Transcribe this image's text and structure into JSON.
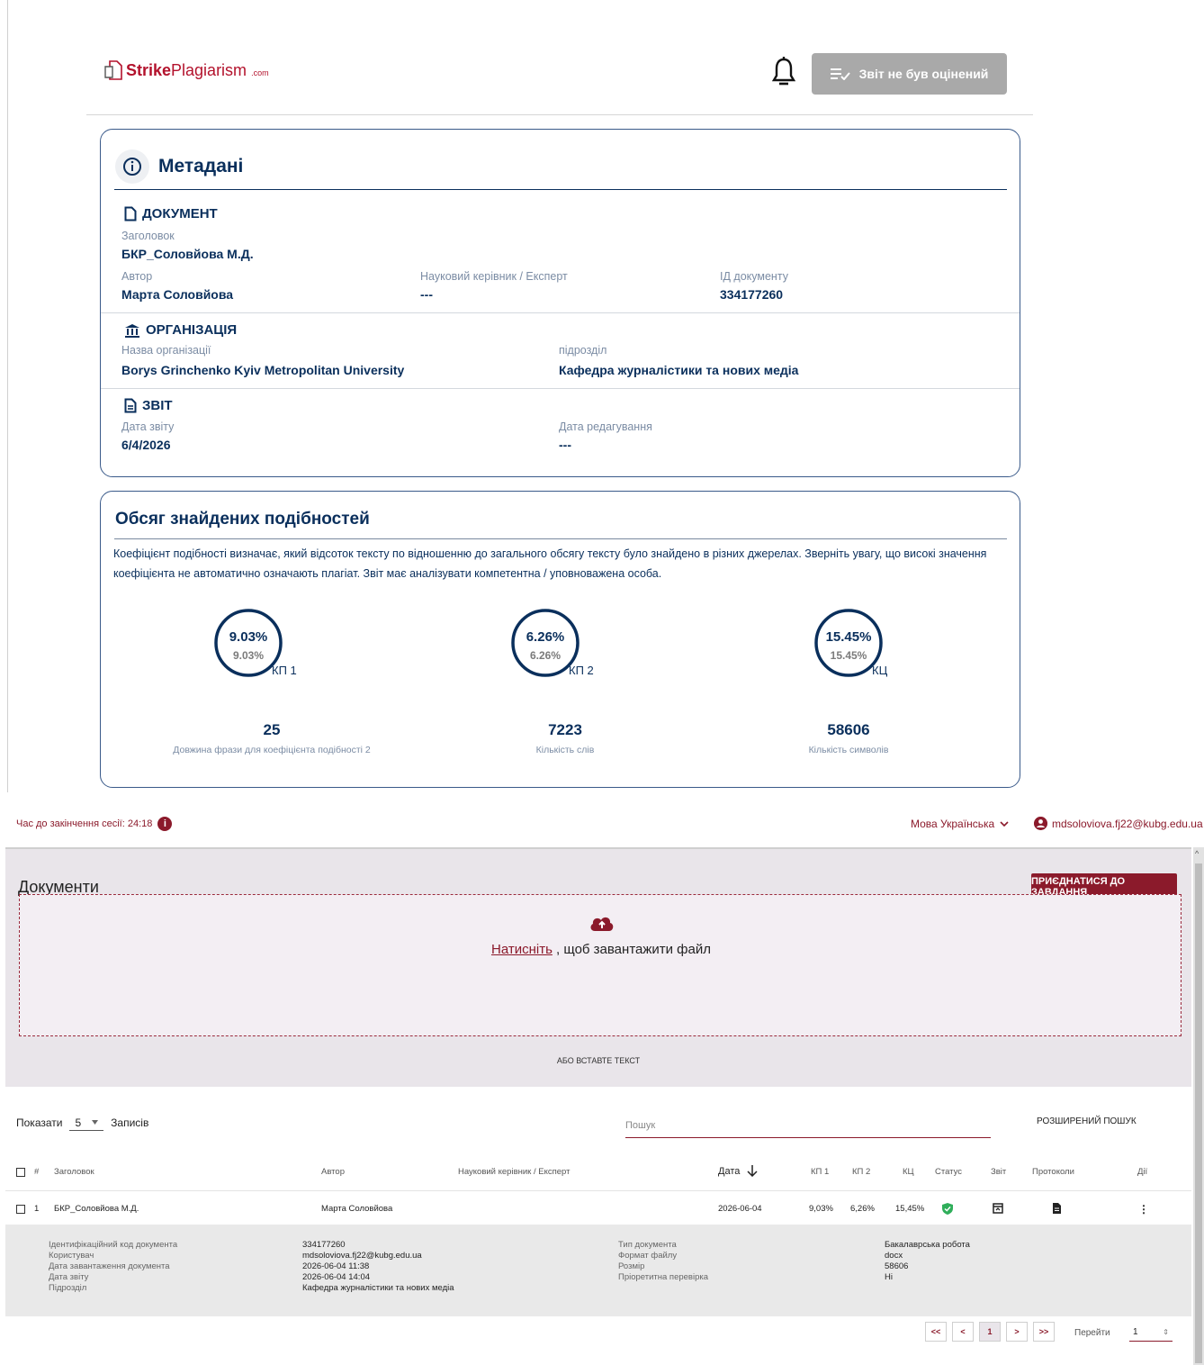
{
  "header": {
    "logo_strike": "Strike",
    "logo_plag": "Plagiarism",
    "logo_com": ".com",
    "eval_button": "Звіт не був оцінений"
  },
  "metadata": {
    "title": "Метадані",
    "document": {
      "heading": "ДОКУМЕНТ",
      "title_label": "Заголовок",
      "title_value": "БКР_Соловйова М.Д.",
      "author_label": "Автор",
      "author_value": "Марта Соловйова",
      "supervisor_label": "Науковий керівник / Експерт",
      "supervisor_value": "---",
      "id_label": "ІД документу",
      "id_value": "334177260"
    },
    "organization": {
      "heading": "ОРГАНІЗАЦІЯ",
      "name_label": "Назва організації",
      "name_value": "Borys Grinchenko Kyiv Metropolitan University",
      "dept_label": "підрозділ",
      "dept_value": "Кафедра журналістики та нових медіа"
    },
    "report": {
      "heading": "ЗВІТ",
      "date_label": "Дата звіту",
      "date_value": "6/4/2026",
      "edit_label": "Дата редагування",
      "edit_value": "---"
    }
  },
  "similarity": {
    "title": "Обсяг знайдених подібностей",
    "description": "Коефіцієнт подібності визначає, який відсоток тексту по відношенню до загального обсягу тексту було знайдено в різних джерелах. Зверніть увагу, що високі значення коефіцієнта не автоматично означають плагіат. Звіт має аналізувати компетентна / уповноважена особа.",
    "gauges": [
      {
        "main": "9.03%",
        "sub": "9.03%",
        "label": "КП 1",
        "value": 9.03
      },
      {
        "main": "6.26%",
        "sub": "6.26%",
        "label": "КП 2",
        "value": 6.26
      },
      {
        "main": "15.45%",
        "sub": "15.45%",
        "label": "КЦ",
        "value": 15.45
      }
    ],
    "stats": [
      {
        "value": "25",
        "label": "Довжина фрази для коефіцієнта подібності 2"
      },
      {
        "value": "7223",
        "label": "Кількість слів"
      },
      {
        "value": "58606",
        "label": "Кількість символів"
      }
    ]
  },
  "app": {
    "session_text": "Час до закінчення сесії: 24:18",
    "language": "Мова Українська",
    "user_email": "mdsoloviova.fj22@kubg.edu.ua",
    "documents_title": "Документи",
    "join_button": "ПРИЄДНАТИСЯ ДО ЗАВДАННЯ",
    "upload_link": "Натисніть",
    "upload_text": " , щоб завантажити файл",
    "paste_text": "АБО ВСТАВТЕ ТЕКСТ",
    "show_label": "Показати",
    "show_value": "5",
    "records_label": "Записів",
    "search_placeholder": "Пошук",
    "advanced_search": "РОЗШИРЕНИЙ ПОШУК",
    "columns": {
      "num": "#",
      "title": "Заголовок",
      "author": "Автор",
      "supervisor": "Науковий керівник / Експерт",
      "date": "Дата",
      "kp1": "КП 1",
      "kp2": "КП 2",
      "kc": "КЦ",
      "status": "Статус",
      "report": "Звіт",
      "protocols": "Протоколи",
      "actions": "Дії"
    },
    "row": {
      "num": "1",
      "title": "БКР_Соловйова М.Д.",
      "author": "Марта Соловйова",
      "supervisor": "",
      "date": "2026-06-04",
      "kp1": "9,03%",
      "kp2": "6,26%",
      "kc": "15,45%"
    },
    "details": {
      "labels_left": [
        "Ідентифікаційний код документа",
        "Користувач",
        "Дата завантаження документа",
        "Дата звіту",
        "Підрозділ"
      ],
      "values_left": [
        "334177260",
        "mdsoloviova.fj22@kubg.edu.ua",
        "2026-06-04 11:38",
        "2026-06-04 14:04",
        "Кафедра журналістики та нових медіа"
      ],
      "labels_right": [
        "Тип документа",
        "Формат файлу",
        "Розмір",
        "Пріоретитна перевірка"
      ],
      "values_right": [
        "Бакалаврська робота",
        "docx",
        "58606",
        "Ні"
      ]
    },
    "pager": {
      "first": "<<",
      "prev": "<",
      "page": "1",
      "next": ">",
      "last": ">>",
      "goto_label": "Перейти",
      "goto_value": "1"
    }
  }
}
